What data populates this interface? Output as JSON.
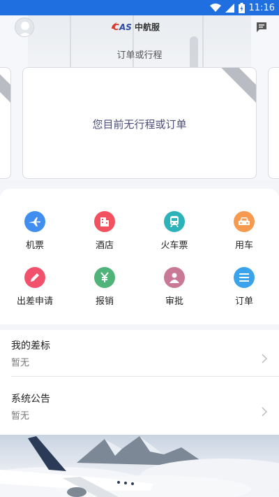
{
  "status_bar": {
    "time": "11:16"
  },
  "header": {
    "brand_logo_text": "CAS中航服",
    "section_title": "订单或行程"
  },
  "trip_card": {
    "empty_message": "您目前无行程或订单"
  },
  "services": [
    {
      "label": "机票",
      "icon": "airplane-icon",
      "color": "#3f8ef0"
    },
    {
      "label": "酒店",
      "icon": "hotel-icon",
      "color": "#f2515f"
    },
    {
      "label": "火车票",
      "icon": "train-icon",
      "color": "#2cb3b9"
    },
    {
      "label": "用车",
      "icon": "car-icon",
      "color": "#f59a4e"
    },
    {
      "label": "出差申请",
      "icon": "pencil-icon",
      "color": "#f2516d"
    },
    {
      "label": "报销",
      "icon": "yuan-icon",
      "color": "#4fb37a"
    },
    {
      "label": "审批",
      "icon": "person-icon",
      "color": "#c97895"
    },
    {
      "label": "订单",
      "icon": "list-icon",
      "color": "#3aa3ec"
    }
  ],
  "list": [
    {
      "title": "我的差标",
      "value": "暂无"
    },
    {
      "title": "系统公告",
      "value": "暂无"
    }
  ]
}
